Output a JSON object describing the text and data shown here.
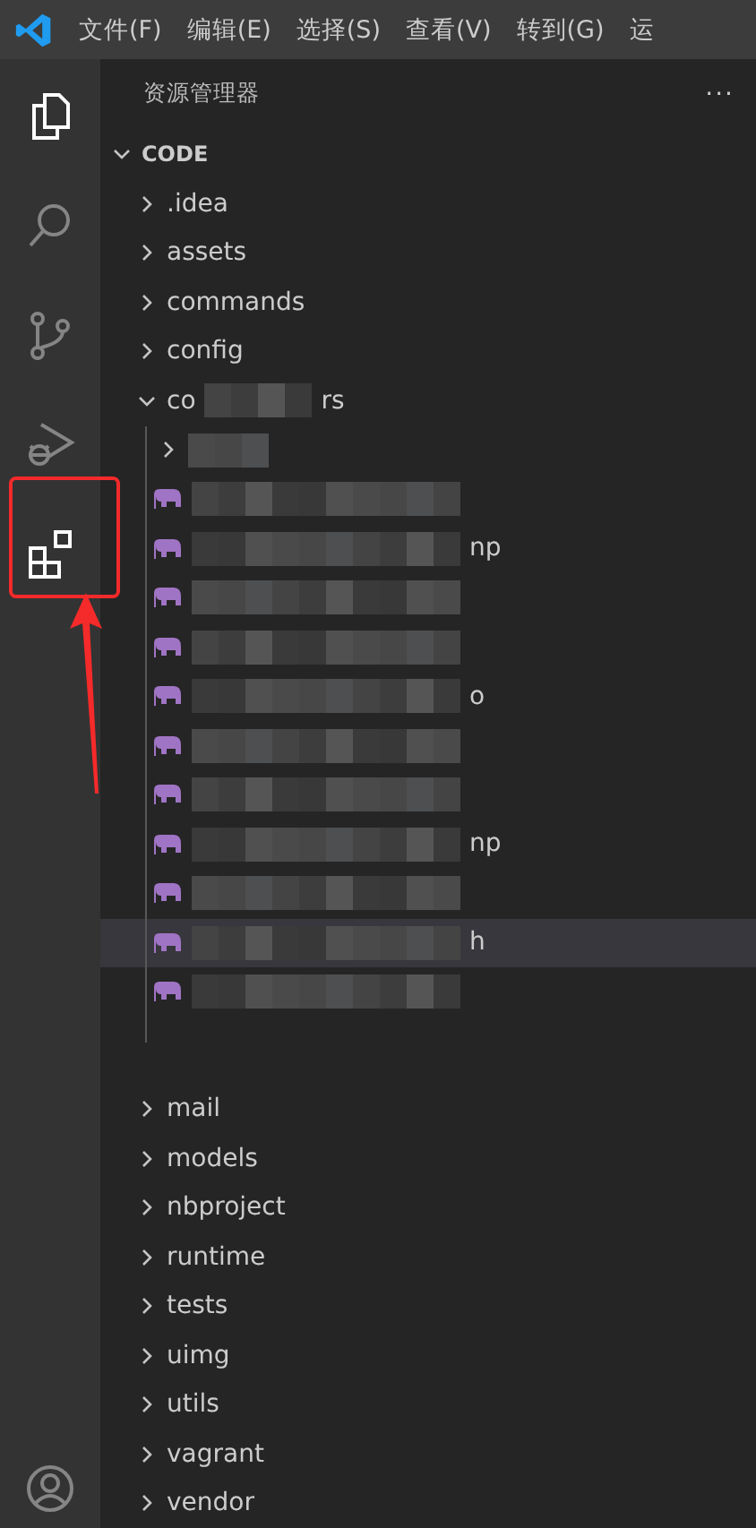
{
  "menu": [
    "文件(F)",
    "编辑(E)",
    "选择(S)",
    "查看(V)",
    "转到(G)",
    "运"
  ],
  "activity_bar": [
    {
      "kind": "files",
      "active": true
    },
    {
      "kind": "search",
      "active": false
    },
    {
      "kind": "source-control",
      "active": false
    },
    {
      "kind": "run-debug",
      "active": false
    },
    {
      "kind": "extensions",
      "active": true
    }
  ],
  "sidebar": {
    "title": "资源管理器",
    "more": "···",
    "root": {
      "label": "CODE",
      "expanded": true
    },
    "items": [
      {
        "kind": "folder",
        "label": ".idea",
        "expanded": false
      },
      {
        "kind": "folder",
        "label": "assets",
        "expanded": false
      },
      {
        "kind": "folder",
        "label": "commands",
        "expanded": false
      },
      {
        "kind": "folder",
        "label": "config",
        "expanded": false
      },
      {
        "kind": "redacted-folder",
        "label_start": "co",
        "label_end": "rs",
        "expanded": true,
        "children": [
          {
            "kind": "redacted-folder",
            "expanded": false
          },
          {
            "kind": "redacted-file",
            "selected": false
          },
          {
            "kind": "redacted-file",
            "tail": "np",
            "selected": false
          },
          {
            "kind": "redacted-file",
            "selected": false
          },
          {
            "kind": "redacted-file",
            "selected": false
          },
          {
            "kind": "redacted-file",
            "tail": "o",
            "selected": false
          },
          {
            "kind": "redacted-file",
            "selected": false
          },
          {
            "kind": "redacted-file",
            "selected": false
          },
          {
            "kind": "redacted-file",
            "tail": "np",
            "selected": false
          },
          {
            "kind": "redacted-file",
            "selected": false
          },
          {
            "kind": "redacted-file",
            "tail": "h",
            "selected": true
          },
          {
            "kind": "redacted-file",
            "selected": false
          }
        ]
      },
      {
        "kind": "folder",
        "label": "mail",
        "expanded": false
      },
      {
        "kind": "folder",
        "label": "models",
        "expanded": false
      },
      {
        "kind": "folder",
        "label": "nbproject",
        "expanded": false
      },
      {
        "kind": "folder",
        "label": "runtime",
        "expanded": false
      },
      {
        "kind": "folder",
        "label": "tests",
        "expanded": false
      },
      {
        "kind": "folder",
        "label": "uimg",
        "expanded": false
      },
      {
        "kind": "folder",
        "label": "utils",
        "expanded": false
      },
      {
        "kind": "folder",
        "label": "vagrant",
        "expanded": false
      },
      {
        "kind": "folder",
        "label": "vendor",
        "expanded": false
      }
    ]
  }
}
